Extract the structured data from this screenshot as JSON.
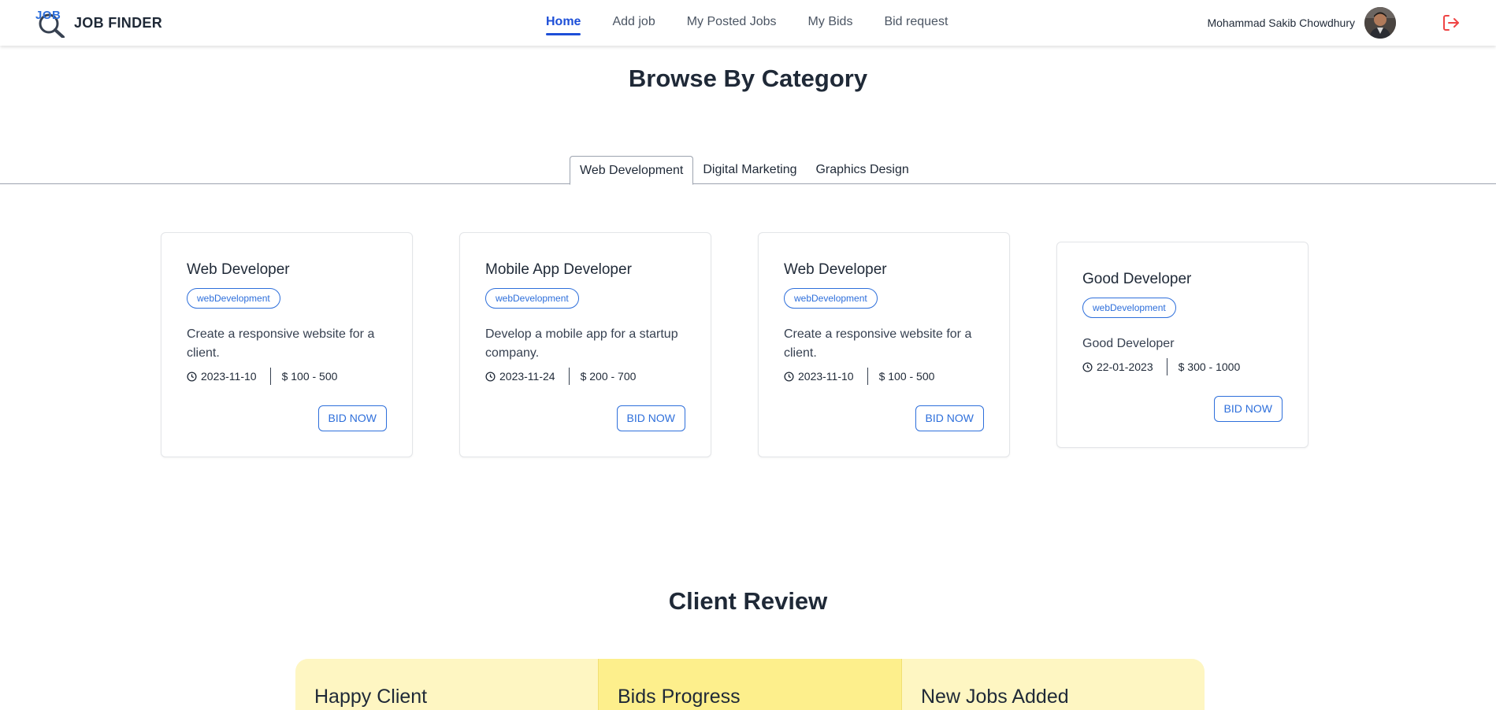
{
  "navbar": {
    "logo_text": "JOB",
    "brand_name": "JOB FINDER",
    "links": [
      {
        "label": "Home",
        "active": true
      },
      {
        "label": "Add job",
        "active": false
      },
      {
        "label": "My Posted Jobs",
        "active": false
      },
      {
        "label": "My Bids",
        "active": false
      },
      {
        "label": "Bid request",
        "active": false
      }
    ],
    "user_name": "Mohammad Sakib Chowdhury",
    "logout_icon": "logout-icon"
  },
  "browse": {
    "title": "Browse By Category",
    "tabs": [
      {
        "label": "Web Development",
        "active": true
      },
      {
        "label": "Digital Marketing",
        "active": false
      },
      {
        "label": "Graphics Design",
        "active": false
      }
    ],
    "cards": [
      {
        "title": "Web Developer",
        "category": "webDevelopment",
        "description": "Create a responsive website for a client.",
        "deadline": "2023-11-10",
        "price": "$ 100 - 500",
        "button": "BID NOW"
      },
      {
        "title": "Mobile App Developer",
        "category": "webDevelopment",
        "description": "Develop a mobile app for a startup company.",
        "deadline": "2023-11-24",
        "price": "$ 200 - 700",
        "button": "BID NOW"
      },
      {
        "title": "Web Developer",
        "category": "webDevelopment",
        "description": "Create a responsive website for a client.",
        "deadline": "2023-11-10",
        "price": "$ 100 - 500",
        "button": "BID NOW"
      },
      {
        "title": "Good Developer",
        "category": "webDevelopment",
        "description": "Good Developer",
        "deadline": "22-01-2023",
        "price": "$ 300 - 1000",
        "button": "BID NOW"
      }
    ]
  },
  "review": {
    "title": "Client Review",
    "stats": [
      {
        "label": "Happy Client"
      },
      {
        "label": "Bids Progress"
      },
      {
        "label": "New Jobs Added"
      }
    ]
  },
  "colors": {
    "accent": "#1d4fd8",
    "badge_blue": "#2e6fdb",
    "stat_light": "#fef6c2",
    "stat_mid": "#fdef8c",
    "logout_red": "#ef4444"
  }
}
